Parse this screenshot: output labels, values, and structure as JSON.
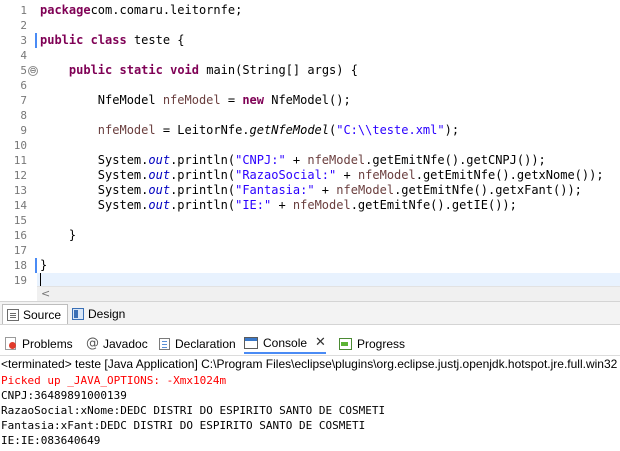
{
  "colors": {
    "keyword": "#7f0055",
    "string": "#2a00ff",
    "local_variable": "#6a3e3e",
    "static_field": "#0000c0",
    "stderr": "#ff0000",
    "active_tab_accent": "#4a8bf5"
  },
  "editor": {
    "line_numbers": [
      "1",
      "2",
      "3",
      "4",
      "5",
      "6",
      "7",
      "8",
      "9",
      "10",
      "11",
      "12",
      "13",
      "14",
      "15",
      "16",
      "17",
      "18",
      "19"
    ],
    "fold_icon": "⊖",
    "lines": [
      {
        "n": 1,
        "tokens": [
          [
            "kw",
            "package"
          ],
          [
            "",
            "com.comaru.leitornfe;"
          ]
        ]
      },
      {
        "n": 2,
        "tokens": []
      },
      {
        "n": 3,
        "tokens": [
          [
            "kw",
            "public"
          ],
          [
            "",
            " "
          ],
          [
            "kw",
            "class"
          ],
          [
            "",
            " teste {"
          ]
        ]
      },
      {
        "n": 4,
        "tokens": []
      },
      {
        "n": 5,
        "tokens": [
          [
            "",
            "    "
          ],
          [
            "kw",
            "public"
          ],
          [
            "",
            " "
          ],
          [
            "kw",
            "static"
          ],
          [
            "",
            " "
          ],
          [
            "kw",
            "void"
          ],
          [
            "",
            " main(String[] args) {"
          ]
        ]
      },
      {
        "n": 6,
        "tokens": []
      },
      {
        "n": 7,
        "tokens": [
          [
            "",
            "        NfeModel "
          ],
          [
            "var",
            "nfeModel"
          ],
          [
            "",
            " = "
          ],
          [
            "kw",
            "new"
          ],
          [
            "",
            " NfeModel();"
          ]
        ]
      },
      {
        "n": 8,
        "tokens": []
      },
      {
        "n": 9,
        "tokens": [
          [
            "",
            "        "
          ],
          [
            "var",
            "nfeModel"
          ],
          [
            "",
            " = LeitorNfe."
          ],
          [
            "smeth",
            "getNfeModel"
          ],
          [
            "",
            "("
          ],
          [
            "str",
            "\"C:\\\\teste.xml\""
          ],
          [
            "",
            ");"
          ]
        ]
      },
      {
        "n": 10,
        "tokens": []
      },
      {
        "n": 11,
        "tokens": [
          [
            "",
            "        System."
          ],
          [
            "fld",
            "out"
          ],
          [
            "",
            ".println("
          ],
          [
            "str",
            "\"CNPJ:\""
          ],
          [
            "",
            " + "
          ],
          [
            "var",
            "nfeModel"
          ],
          [
            "",
            ".getEmitNfe().getCNPJ());"
          ]
        ]
      },
      {
        "n": 12,
        "tokens": [
          [
            "",
            "        System."
          ],
          [
            "fld",
            "out"
          ],
          [
            "",
            ".println("
          ],
          [
            "str",
            "\"RazaoSocial:\""
          ],
          [
            "",
            " + "
          ],
          [
            "var",
            "nfeModel"
          ],
          [
            "",
            ".getEmitNfe().getxNome());"
          ]
        ]
      },
      {
        "n": 13,
        "tokens": [
          [
            "",
            "        System."
          ],
          [
            "fld",
            "out"
          ],
          [
            "",
            ".println("
          ],
          [
            "str",
            "\"Fantasia:\""
          ],
          [
            "",
            " + "
          ],
          [
            "var",
            "nfeModel"
          ],
          [
            "",
            ".getEmitNfe().getxFant());"
          ]
        ]
      },
      {
        "n": 14,
        "tokens": [
          [
            "",
            "        System."
          ],
          [
            "fld",
            "out"
          ],
          [
            "",
            ".println("
          ],
          [
            "str",
            "\"IE:\""
          ],
          [
            "",
            " + "
          ],
          [
            "var",
            "nfeModel"
          ],
          [
            "",
            ".getEmitNfe().getIE());"
          ]
        ]
      },
      {
        "n": 15,
        "tokens": []
      },
      {
        "n": 16,
        "tokens": [
          [
            "",
            "    }"
          ]
        ]
      },
      {
        "n": 17,
        "tokens": []
      },
      {
        "n": 18,
        "tokens": [
          [
            "",
            "}"
          ]
        ]
      },
      {
        "n": 19,
        "tokens": []
      }
    ],
    "scroll_left_arrow": "<"
  },
  "editor_tabs": {
    "source_label": "Source",
    "design_label": "Design"
  },
  "views": {
    "problems_label": "Problems",
    "javadoc_at": "@",
    "javadoc_label": "Javadoc",
    "declaration_label": "Declaration",
    "console_label": "Console",
    "console_close": "✕",
    "progress_label": "Progress"
  },
  "console": {
    "header": "<terminated> teste [Java Application] C:\\Program Files\\eclipse\\plugins\\org.eclipse.justj.openjdk.hotspot.jre.full.win32",
    "stderr_line": "Picked up _JAVA_OPTIONS: -Xmx1024m",
    "output": [
      "CNPJ:36489891000139",
      "RazaoSocial:xNome:DEDC DISTRI DO ESPIRITO SANTO DE COSMETI",
      "Fantasia:xFant:DEDC DISTRI DO ESPIRITO SANTO DE COSMETI",
      "IE:IE:083640649"
    ]
  }
}
